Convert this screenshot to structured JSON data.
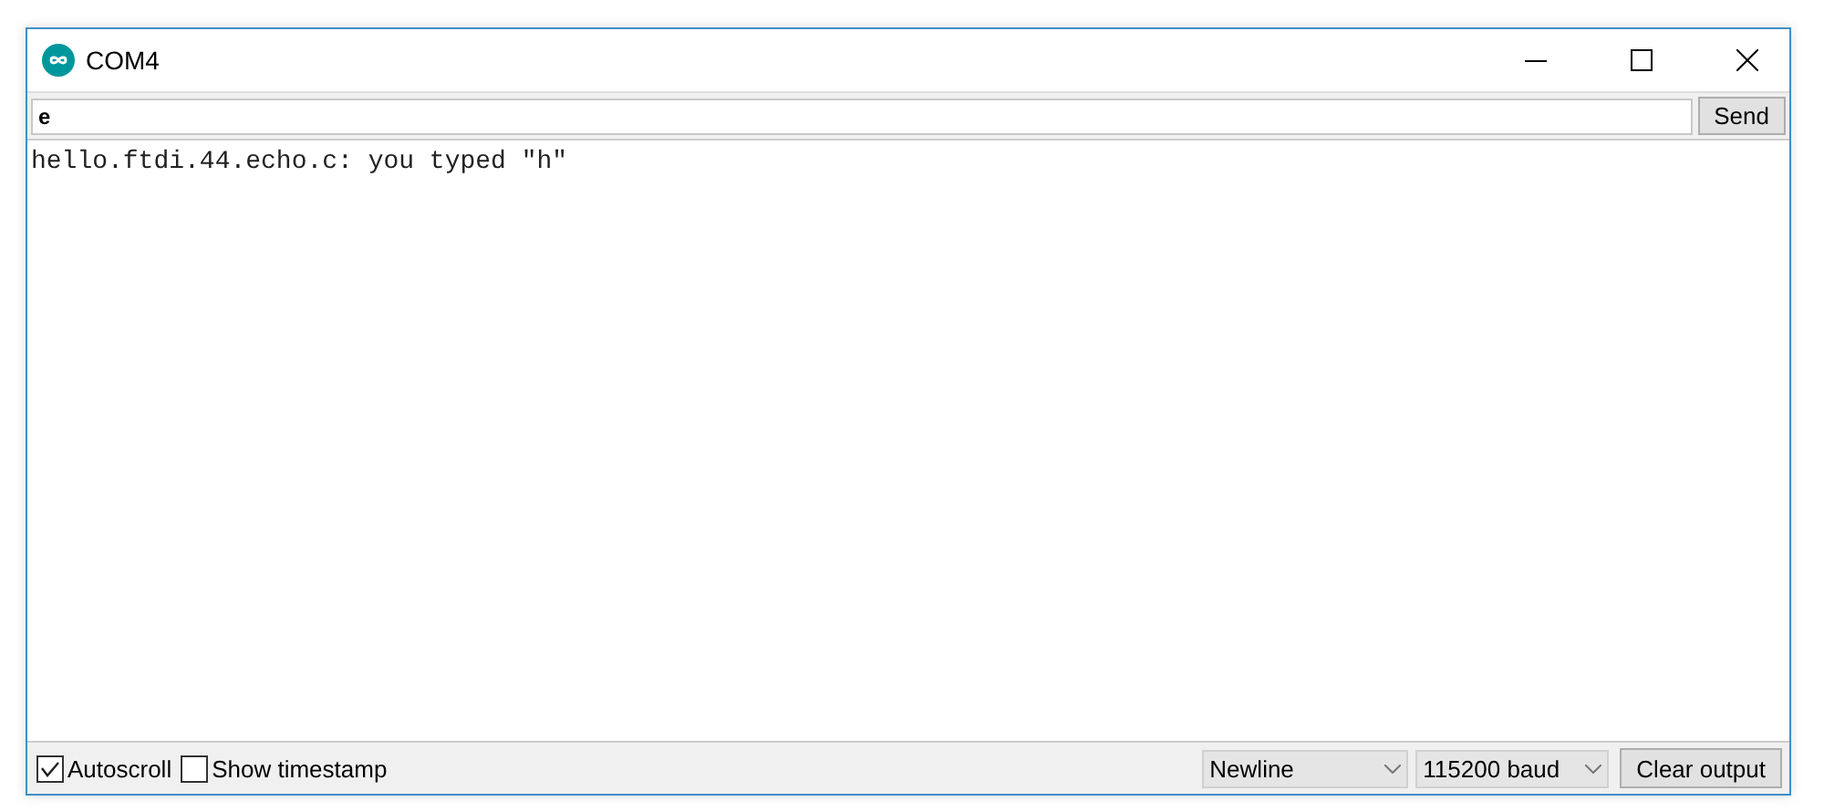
{
  "window": {
    "title": "COM4"
  },
  "input": {
    "value": "e"
  },
  "send_button": "Send",
  "output": [
    "hello.ftdi.44.echo.c: you typed \"h\""
  ],
  "options": [
    {
      "label": "Autoscroll",
      "checked": true
    },
    {
      "label": "Show timestamp",
      "checked": false
    }
  ],
  "line_ending": "Newline",
  "baud_rate": "115200 baud",
  "clear_button": "Clear output"
}
